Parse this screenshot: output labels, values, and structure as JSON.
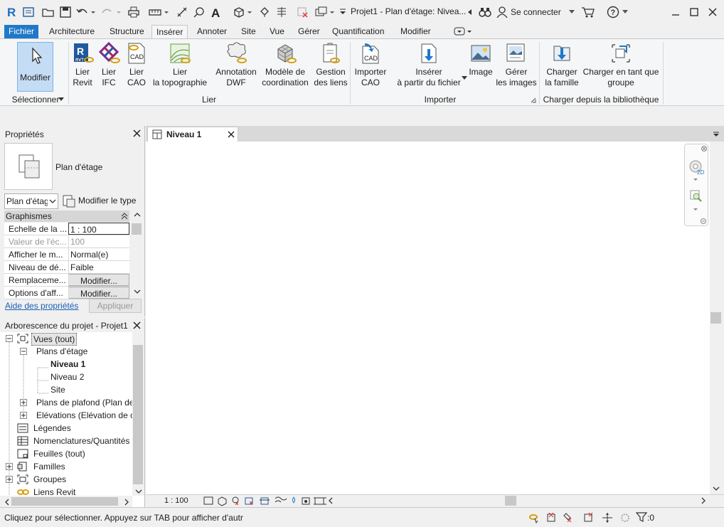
{
  "title": "Projet1 - Plan d'étage: Nivea...",
  "signin": "Se connecter",
  "tabs": [
    "Fichier",
    "Architecture",
    "Structure",
    "Insérer",
    "Annoter",
    "Site",
    "Vue",
    "Gérer",
    "Quantification",
    "Modifier"
  ],
  "ribbon": {
    "modify": "Modifier",
    "select_panel": "Sélectionner",
    "lier_panel": "Lier",
    "importer_panel": "Importer",
    "library_panel": "Charger depuis la bibliothèque",
    "buttons": {
      "lier_revit_1": "Lier",
      "lier_revit_2": "Revit",
      "lier_ifc_1": "Lier",
      "lier_ifc_2": "IFC",
      "lier_cao_1": "Lier",
      "lier_cao_2": "CAO",
      "lier_topo_1": "Lier",
      "lier_topo_2": "la topographie",
      "dwf_1": "Annotation",
      "dwf_2": "DWF",
      "coord_1": "Modèle de",
      "coord_2": "coordination",
      "gestion_1": "Gestion",
      "gestion_2": "des liens",
      "import_cao_1": "Importer",
      "import_cao_2": "CAO",
      "insert_file_1": "Insérer",
      "insert_file_2": "à partir du fichier",
      "image": "Image",
      "manage_images_1": "Gérer",
      "manage_images_2": "les images",
      "load_family_1": "Charger",
      "load_family_2": "la famille",
      "load_group_1": "Charger en tant que",
      "load_group_2": "groupe"
    },
    "icon_labels": {
      "rvt": "RVT",
      "cad": "CAD"
    }
  },
  "properties": {
    "title": "Propriétés",
    "type_name": "Plan d'étage",
    "type_select": "Plan d'étag",
    "edit_type": "Modifier le type",
    "category": "Graphismes",
    "rows": [
      {
        "k": "Echelle de la ...",
        "v": "1 : 100"
      },
      {
        "k": "Valeur de l'éc...",
        "v": "100"
      },
      {
        "k": "Afficher le m...",
        "v": "Normal(e)"
      },
      {
        "k": "Niveau de dé...",
        "v": "Faible"
      },
      {
        "k": "Remplaceme...",
        "v": "Modifier..."
      },
      {
        "k": "Options d'aff...",
        "v": "Modifier..."
      }
    ],
    "help": "Aide des propriétés",
    "apply": "Appliquer"
  },
  "browser": {
    "title": "Arborescence du projet - Projet1",
    "items": {
      "views": "Vues (tout)",
      "floor_plans": "Plans d'étage",
      "niveau1": "Niveau 1",
      "niveau2": "Niveau 2",
      "site": "Site",
      "ceiling": "Plans de plafond (Plan de",
      "elevations": "Elévations (Elévation de c",
      "legends": "Légendes",
      "schedules": "Nomenclatures/Quantités",
      "sheets": "Feuilles (tout)",
      "families": "Familles",
      "groups": "Groupes",
      "revit_links": "Liens Revit"
    }
  },
  "view": {
    "tab": "Niveau 1",
    "scale": "1 : 100",
    "nav_2d": "2D"
  },
  "status": {
    "text": "Cliquez pour sélectionner. Appuyez sur TAB pour afficher d'autr",
    "filter_count": ":0"
  },
  "colors": {
    "accent": "#1f78c8",
    "active_button": "#c5dcf5"
  }
}
